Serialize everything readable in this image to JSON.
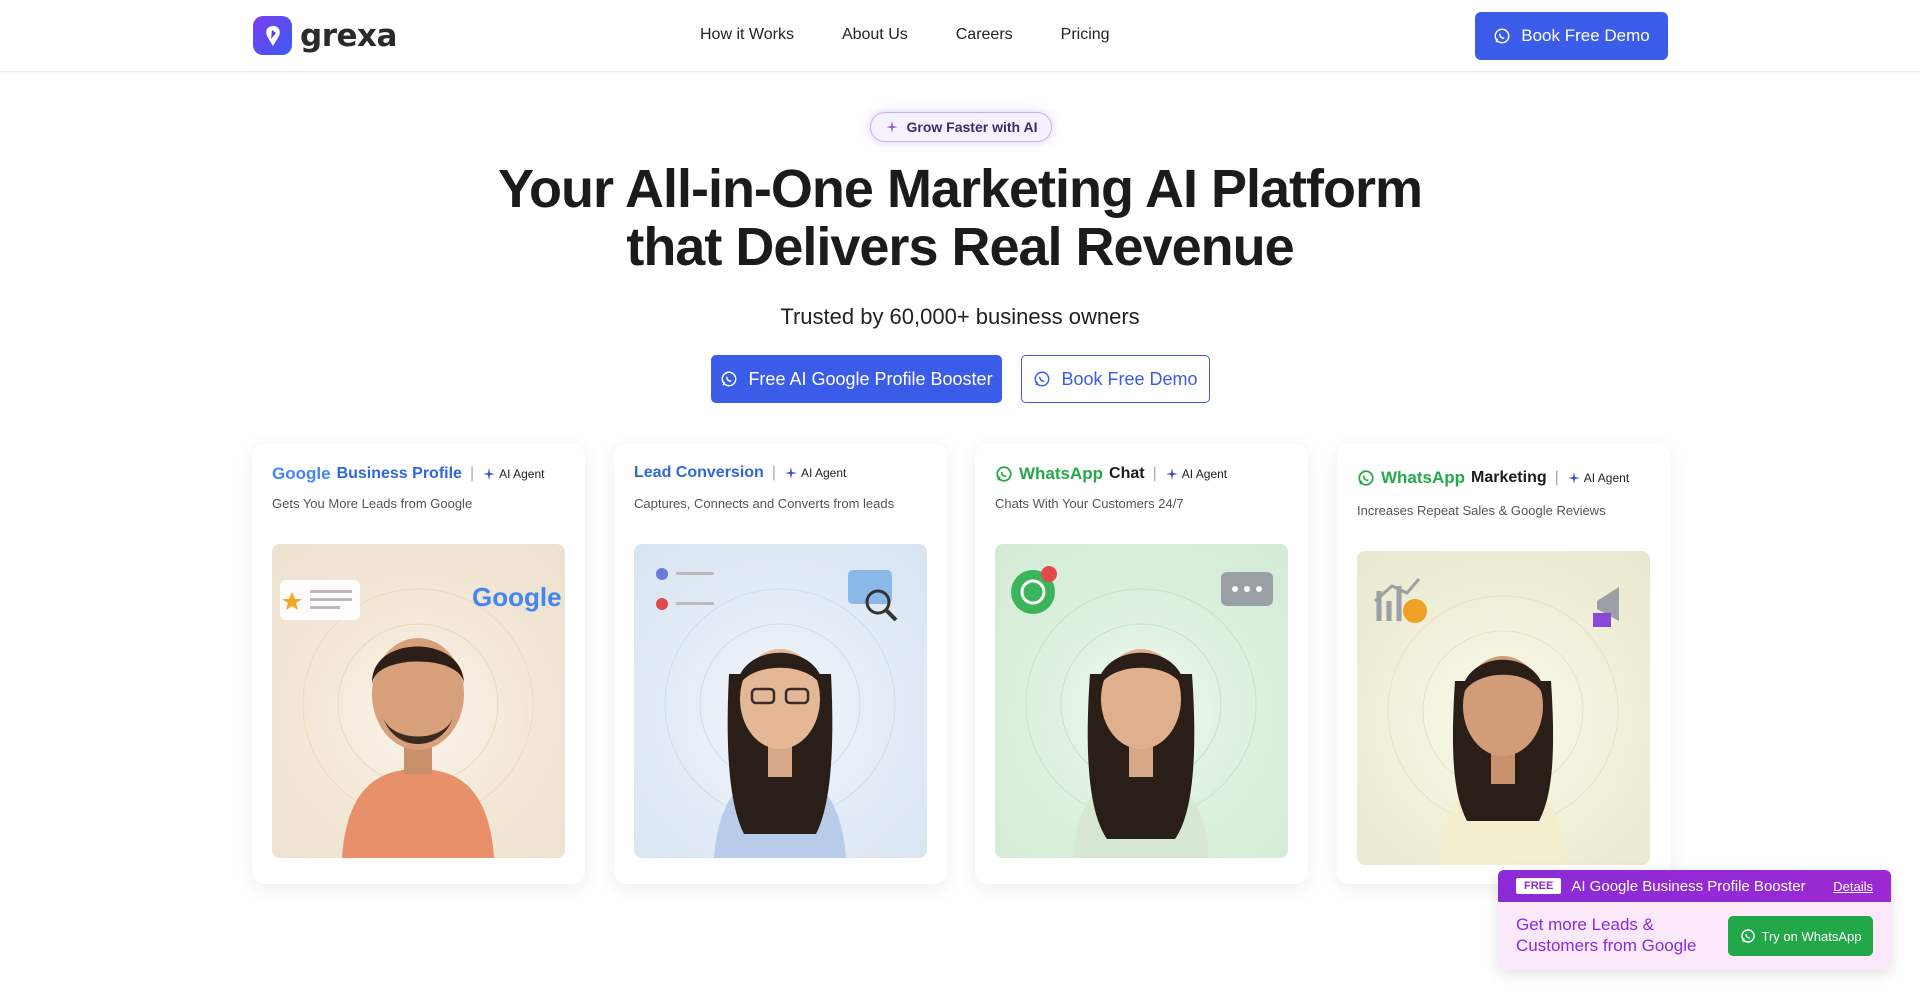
{
  "brand": {
    "name": "grexa"
  },
  "nav": {
    "links": [
      "How it Works",
      "About Us",
      "Careers",
      "Pricing"
    ],
    "cta_label": "Book Free Demo"
  },
  "hero": {
    "pill_label": "Grow Faster with AI",
    "title_line1": "Your All-in-One Marketing AI Platform",
    "title_line2": "that Delivers Real Revenue",
    "subtitle": "Trusted by 60,000+ business owners",
    "primary_button": "Free AI Google Profile Booster",
    "secondary_button": "Book Free Demo"
  },
  "cards": [
    {
      "brand": "Google",
      "title": "Business Profile",
      "agent": "AI Agent",
      "desc": "Gets You More Leads from Google",
      "accent": "#2f68d8",
      "bg": "#f4ead9"
    },
    {
      "brand": "",
      "title": "Lead Conversion",
      "agent": "AI Agent",
      "desc": "Captures, Connects and Converts from leads",
      "accent": "#2f68d8",
      "bg": "#e6eef8"
    },
    {
      "brand": "WhatsApp",
      "title": "Chat",
      "agent": "AI Agent",
      "desc": "Chats With Your Customers 24/7",
      "accent": "#25a84a",
      "bg": "#e5f3e8"
    },
    {
      "brand": "WhatsApp",
      "title": "Marketing",
      "agent": "AI Agent",
      "desc": "Increases Repeat Sales & Google Reviews",
      "accent": "#25a84a",
      "bg": "#f3f2dc"
    }
  ],
  "promo": {
    "badge": "FREE",
    "title": "AI Google Business Profile Booster",
    "details": "Details",
    "body": "Get more Leads & Customers from Google",
    "button": "Try on WhatsApp"
  }
}
